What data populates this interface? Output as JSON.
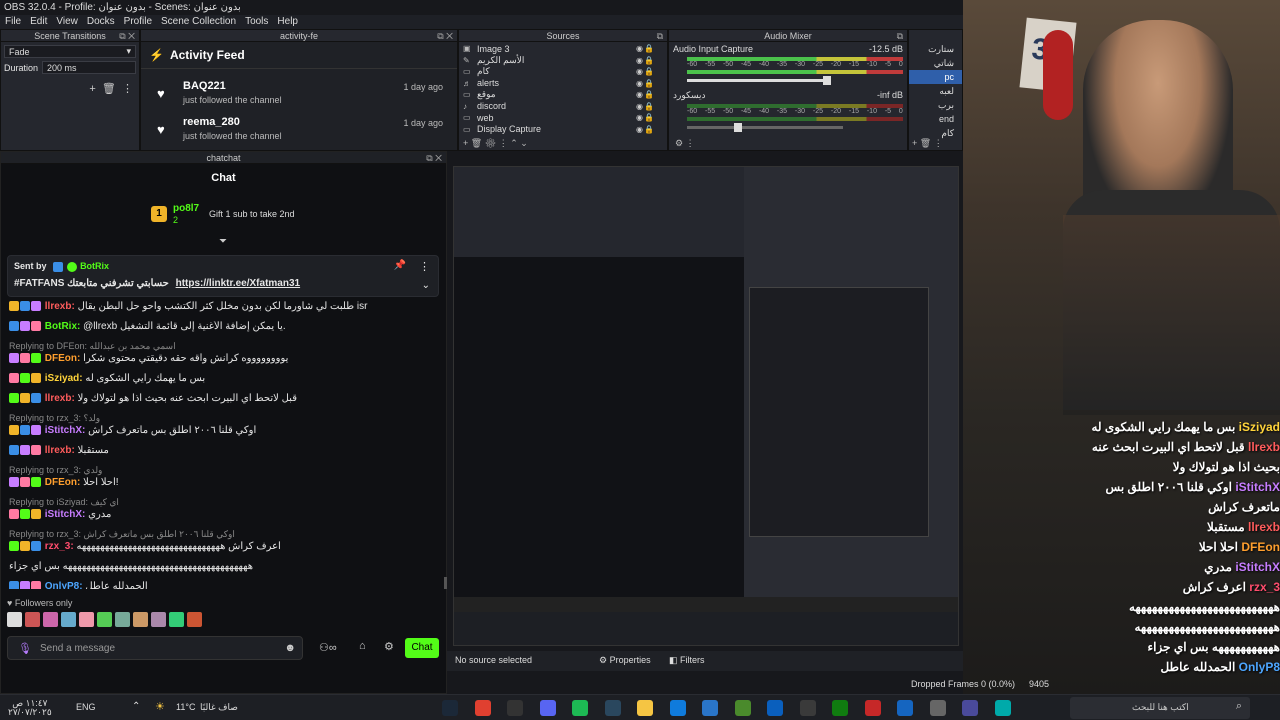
{
  "window": {
    "title": "OBS 32.0.4 - Profile: بدون عنوان - Scenes: بدون عنوان"
  },
  "menu": [
    "File",
    "Edit",
    "View",
    "Docks",
    "Profile",
    "Scene Collection",
    "Tools",
    "Help"
  ],
  "transitions": {
    "header": "Scene Transitions",
    "selected": "Fade",
    "duration_label": "Duration",
    "duration_value": "200 ms"
  },
  "activity": {
    "dock_title": "activity-fe",
    "title": "Activity Feed",
    "items": [
      {
        "user": "BAQ221",
        "text": "just followed the channel",
        "time": "1 day ago"
      },
      {
        "user": "reema_280",
        "text": "just followed the channel",
        "time": "1 day ago"
      }
    ]
  },
  "sources": {
    "header": "Sources",
    "items": [
      "Image 3",
      "الأسم الكريم",
      "كام",
      "alerts",
      "موقع",
      "discord",
      "web",
      "Display Capture"
    ]
  },
  "mixer": {
    "header": "Audio Mixer",
    "channels": [
      {
        "name": "Audio Input Capture",
        "level": "-12.5 dB"
      },
      {
        "name": "ديسكورد",
        "level": "-inf dB"
      }
    ],
    "scale": [
      "-60",
      "-55",
      "-50",
      "-45",
      "-40",
      "-35",
      "-30",
      "-25",
      "-20",
      "-15",
      "-10",
      "-5",
      "0"
    ]
  },
  "scenes": {
    "items": [
      "ستارت",
      "شاتي",
      "pc",
      "لعبه",
      "برب",
      "end",
      "كام"
    ],
    "selected_index": 2
  },
  "chat": {
    "dock_title": "chatchat",
    "title": "Chat",
    "gift": {
      "user": "po8l7",
      "count": "2",
      "text": "Gift 1 sub to take 2nd"
    },
    "pinned": {
      "sent_by_label": "Sent by",
      "sender": "BotRix",
      "message": "#FATFANS حسابتي تشرفني متابعتك",
      "link": "https://linktr.ee/Xfatman31"
    },
    "messages": [
      {
        "reply": "",
        "user": "llrexb:",
        "text": "طلبت لي شاورما لكن بدون مخلل كثر الكتشب واحو حل البطن يقال isr",
        "color": "#ff5c5c"
      },
      {
        "reply": "",
        "user": "BotRix:",
        "text": "@llrexb يا يمكن إضافة الأغنية إلى قائمة التشغيل.",
        "color": "#53fc18"
      },
      {
        "reply": "Replying to DFEon: اسمي محمد بن عبدالله",
        "user": "DFEon:",
        "text": "يووووووووه كرانش واقه حقه دقيقتي محتوى شكرا",
        "color": "#ff9f2e"
      },
      {
        "reply": "",
        "user": "iSziyad:",
        "text": "بس ما يهمك رايي الشكوى له",
        "color": "#ffd43b"
      },
      {
        "reply": "",
        "user": "llrexb:",
        "text": "قبل لاتحط اي البيرت ابحث عنه بحيث اذا هو لتولاك ولا",
        "color": "#ff5c5c"
      },
      {
        "reply": "Replying to rzx_3: ولد؟",
        "user": "iStitchX:",
        "text": "اوكي قلنا ٢٠٠٦ اطلق بس ماتعرف كراش",
        "color": "#c77dff"
      },
      {
        "reply": "",
        "user": "llrexb:",
        "text": "مستقبلا",
        "color": "#ff5c5c"
      },
      {
        "reply": "Replying to rzx_3: ولدي",
        "user": "DFEon:",
        "text": "احلا احلا!",
        "color": "#ff9f2e"
      },
      {
        "reply": "Replying to iSziyad: اي كيف",
        "user": "iStitchX:",
        "text": "مدري",
        "color": "#c77dff"
      },
      {
        "reply": "Replying to rzx_3: اوكي قلنا ٢٠٠٦ اطلق بس ماتعرف كراش",
        "user": "rzx_3:",
        "text": "اعرف كراش هههههههههههههههههههههههههههههههه",
        "color": "#ff4d6d"
      },
      {
        "reply": "",
        "user": "",
        "text": "ههههههههههههههههههههههههههههههههههههههههه بس اي جزاء",
        "color": "#ffffff"
      },
      {
        "reply": "",
        "user": "OnlyP8:",
        "text": "الحمدلله عاطل",
        "color": "#4da6ff"
      }
    ],
    "followers_only": "Followers only",
    "input_placeholder": "Send a message",
    "send_label": "Chat"
  },
  "preview": {
    "status": "No source selected",
    "properties": "Properties",
    "filters": "Filters",
    "dropped": "Dropped Frames 0 (0.0%)",
    "counter": "9405"
  },
  "overlay_chat": [
    {
      "user": "iSziyad",
      "text": "بس ما يهمك رايي الشكوى له",
      "color": "#ffd43b"
    },
    {
      "user": "llrexb",
      "text": "قبل لاتحط اي البيرت ابحث عنه",
      "color": "#ff5c5c"
    },
    {
      "user": "",
      "text": "بحيث اذا هو لتولاك ولا",
      "color": "#ffffff"
    },
    {
      "user": "iStitchX",
      "text": "اوكي قلنا ٢٠٠٦ اطلق بس",
      "color": "#c77dff"
    },
    {
      "user": "",
      "text": "ماتعرف كراش",
      "color": "#ffffff"
    },
    {
      "user": "llrexb",
      "text": "مستقبلا",
      "color": "#ff5c5c"
    },
    {
      "user": "DFEon",
      "text": "احلا احلا",
      "color": "#ff9f2e"
    },
    {
      "user": "iStitchX",
      "text": "مدري",
      "color": "#c77dff"
    },
    {
      "user": "rzx_3",
      "text": "اعرف كراش",
      "color": "#ff4d6d"
    },
    {
      "user": "",
      "text": "ههههههههههههههههههههههههههه",
      "color": "#ffffff"
    },
    {
      "user": "",
      "text": "هههههههههههههههههههههههههه",
      "color": "#ffffff"
    },
    {
      "user": "",
      "text": "هههههههههههه بس اي جزاء",
      "color": "#ffffff"
    },
    {
      "user": "OnlyP8",
      "text": "الحمدلله عاطل",
      "color": "#4da6ff"
    }
  ],
  "cam_jersey_number": "31",
  "taskbar": {
    "time": "١١:٤٧ ص",
    "date": "٢٧/٠٧/٢٠٢٥",
    "language": "ENG",
    "weather": "11°C",
    "weather_text": "صاف غالبًا",
    "search_placeholder": "اكتب هنا للبحث"
  },
  "colors": {
    "accent_green": "#53fc18",
    "obs_bg": "#25272e"
  }
}
